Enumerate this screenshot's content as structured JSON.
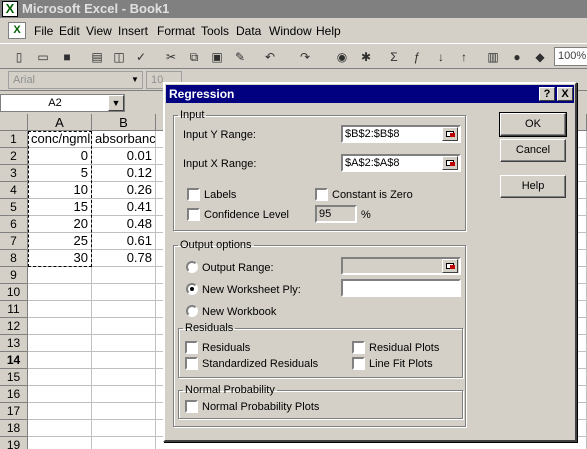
{
  "app": {
    "title": "Microsoft Excel - Book1"
  },
  "menu": [
    "File",
    "Edit",
    "View",
    "Insert",
    "Format",
    "Tools",
    "Data",
    "Window",
    "Help"
  ],
  "toolbar": {
    "zoom": "100%"
  },
  "format_bar": {
    "font": "Arial",
    "size": "10"
  },
  "name_box": "A2",
  "sheet": {
    "columns": [
      "A",
      "B"
    ],
    "rows": [
      "1",
      "2",
      "3",
      "4",
      "5",
      "6",
      "7",
      "8",
      "9",
      "10",
      "11",
      "12",
      "13",
      "14",
      "15",
      "16",
      "17",
      "18",
      "19"
    ],
    "data": [
      [
        "conc/ngml",
        "absorbance"
      ],
      [
        "0",
        "0.01"
      ],
      [
        "5",
        "0.12"
      ],
      [
        "10",
        "0.26"
      ],
      [
        "15",
        "0.41"
      ],
      [
        "20",
        "0.48"
      ],
      [
        "25",
        "0.61"
      ],
      [
        "30",
        "0.78"
      ]
    ]
  },
  "dialog": {
    "title": "Regression",
    "help_glyph": "?",
    "close_glyph": "X",
    "input": {
      "legend": "Input",
      "y_range_label": "Input Y Range:",
      "y_range_value": "$B$2:$B$8",
      "x_range_label": "Input X Range:",
      "x_range_value": "$A$2:$A$8",
      "labels_label": "Labels",
      "labels_checked": false,
      "constant_zero_label": "Constant is Zero",
      "constant_zero_checked": false,
      "confidence_label": "Confidence Level",
      "confidence_value": "95",
      "confidence_unit": "%"
    },
    "output": {
      "legend": "Output options",
      "output_range_label": "Output Range:",
      "new_worksheet_label": "New Worksheet Ply:",
      "new_workbook_label": "New Workbook",
      "selected": "new_worksheet"
    },
    "residuals": {
      "legend": "Residuals",
      "residuals_label": "Residuals",
      "standardized_label": "Standardized Residuals",
      "residual_plots_label": "Residual Plots",
      "line_fit_label": "Line Fit Plots"
    },
    "normal_probability": {
      "legend": "Normal Probability",
      "plots_label": "Normal Probability Plots"
    },
    "buttons": {
      "ok": "OK",
      "cancel": "Cancel",
      "help": "Help"
    }
  }
}
